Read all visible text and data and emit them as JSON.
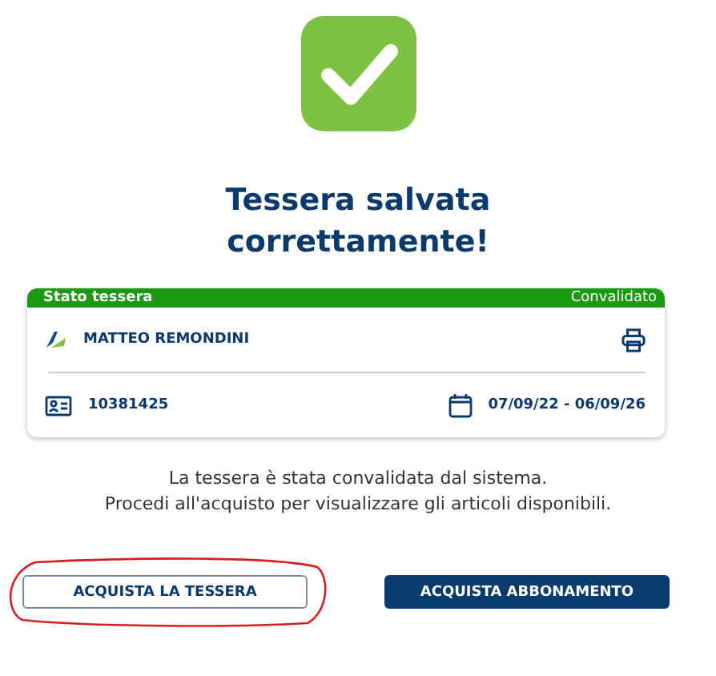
{
  "title": "Tessera salvata correttamente!",
  "card": {
    "header": "Stato tessera",
    "status": "Convalidato",
    "name": "MATTEO REMONDINI",
    "number": "10381425",
    "validity": "07/09/22 - 06/09/26"
  },
  "message": [
    "La tessera è stata convalidata dal sistema.",
    "Procedi all'acquisto per visualizzare gli articoli disponibili."
  ],
  "buttons": [
    {
      "label": "ACQUISTA LA TESSERA",
      "kind": "outline",
      "circled": true
    },
    {
      "label": "ACQUISTA ABBONAMENTO",
      "kind": "filled",
      "circled": false
    }
  ]
}
